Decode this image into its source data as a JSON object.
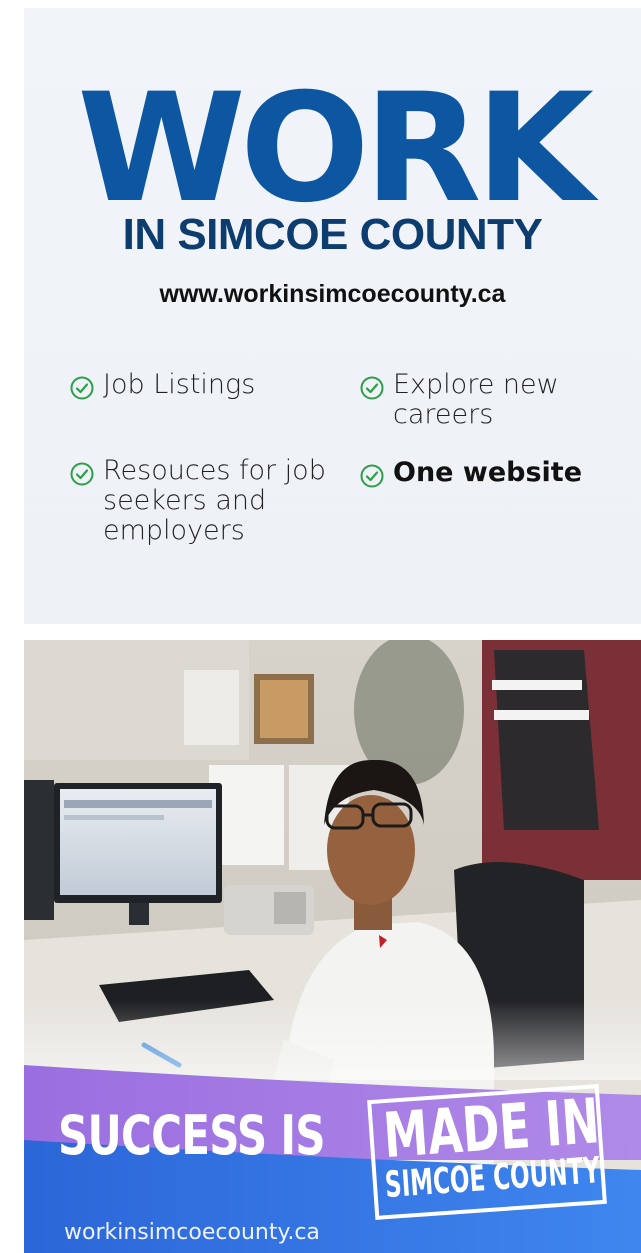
{
  "card1": {
    "headline": "WORK",
    "subheadline": "IN SIMCOE COUNTY",
    "website": "www.workinsimcoecounty.ca",
    "features": [
      {
        "text": "Job Listings"
      },
      {
        "text": "Explore new careers"
      },
      {
        "text": "Resouces for job seekers and employers"
      },
      {
        "text": "One website"
      }
    ],
    "colors": {
      "brand_blue": "#0d57a2",
      "dark_blue": "#0d3c6e",
      "check_green": "#2e9e48"
    }
  },
  "card2": {
    "slogan": "SUCCESS IS",
    "stamp_top": "MADE IN",
    "stamp_bottom": "SIMCOE COUNTY",
    "footer_url": "workinsimcoecounty.ca",
    "colors": {
      "purple": "#8a5bd6",
      "blue": "#2f6fe0"
    }
  }
}
